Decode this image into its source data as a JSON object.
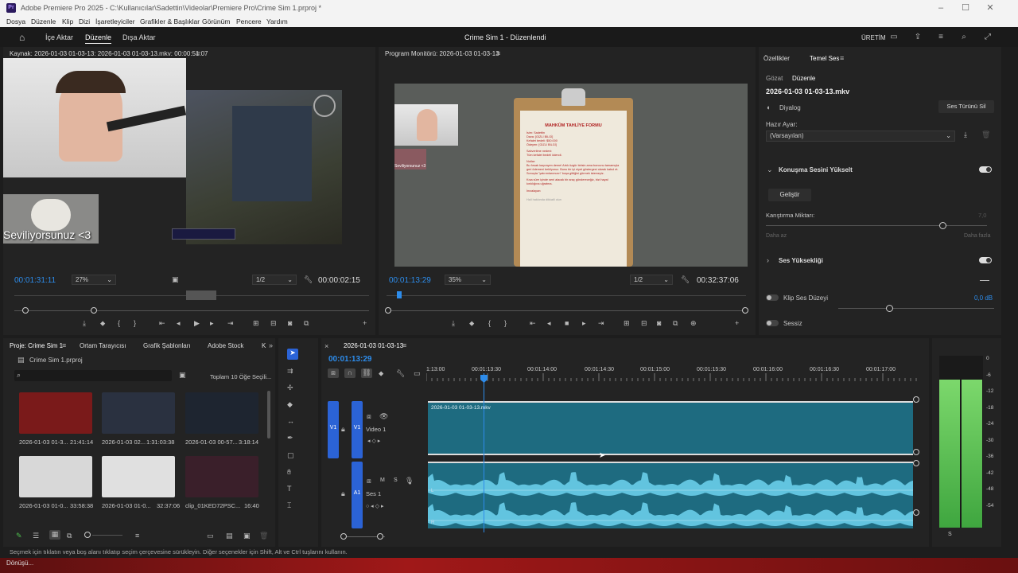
{
  "app": {
    "title": "Adobe Premiere Pro 2025 - C:\\Kullanıcılar\\Sadettin\\Videolar\\Premiere Pro\\Crime Sim 1.prproj *",
    "logo": "Pr"
  },
  "menu": [
    "Dosya",
    "Düzenle",
    "Klip",
    "Dizi",
    "İşaretleyiciler",
    "Grafikler & Başlıklar",
    "Görünüm",
    "Pencere",
    "Yardım"
  ],
  "workspace": {
    "tabs": [
      "İçe Aktar",
      "Düzenle",
      "Dışa Aktar"
    ],
    "project_title": "Crime Sim 1 - Düzenlendi",
    "output": "ÜRETİM"
  },
  "source": {
    "header": "Kaynak: 2026-01-03 01-03-13: 2026-01-03 01-03-13.mkv: 00:00:51:07",
    "timecode": "00:01:31:11",
    "zoom": "27%",
    "res": "1/2",
    "duration": "00:00:02:15",
    "overlay_text": "Seviliyorsunuz <3"
  },
  "program": {
    "header": "Program Monitörü: 2026-01-03 01-03-13",
    "timecode": "00:01:13:29",
    "zoom": "35%",
    "res": "1/2",
    "duration": "00:32:37:06",
    "doc_title": "MAHKÛM TAHLİYE FORMU",
    "small_overlay": "Seviliyorsunuz <3",
    "doc_lines": [
      "İsim: Sadettin",
      "Dava: [GİZLİ BİLGİ]",
      "Kefalet bedeli: $50.000",
      "Ödeyen: [GİZLİ BİLGİ]",
      "Salıverilme nedeni:",
      "Tüm kefalet bedeli ödendi.",
      "Notlar:",
      "Bu fırsatı kaçırayım deme! Artık özgür birisin ama borcunu tamamıyla geri ödemeni bekliyoruz. Bunu bir iyi niyet göstergesi olarak kabul et. Sonuçta \"yatırımlarımızın\" boşa gittiğini görmek istemeyiz.",
      "Kısa süre içinde seni alacak bir araç göndereceğiz, bizi hayal kırıklığına uğratma.",
      "İmzalayan:",
      "Hali hakkında dikkatli olun"
    ]
  },
  "props": {
    "tabs": [
      "Özellikler",
      "Temel Ses"
    ],
    "subtabs": [
      "Gözat",
      "Düzenle"
    ],
    "clip": "2026-01-03 01-03-13.mkv",
    "type": "Diyalog",
    "clear_btn": "Ses Türünü Sil",
    "preset_label": "Hazır Ayar:",
    "preset": "(Varsayılan)",
    "section1": "Konuşma Sesini Yükselt",
    "enhance_btn": "Geliştir",
    "mix_label": "Karıştırma Miktarı:",
    "mix_value": "7,0",
    "mix_level": 0.8,
    "less": "Daha az",
    "more": "Daha fazla",
    "section2": "Ses Yüksekliği",
    "clip_vol": "Klip Ses Düzeyi",
    "clip_vol_value": "0,0 dB",
    "mute": "Sessiz"
  },
  "project": {
    "tabs": [
      "Proje: Crime Sim 1",
      "Ortam Tarayıcısı",
      "Grafik Şablonları",
      "Adobe Stock",
      "K"
    ],
    "file": "Crime Sim 1.prproj",
    "search_placeholder": "",
    "count": "Toplam 10 Öğe Seçili...",
    "items": [
      {
        "name": "2026-01-03 01-3...",
        "dur": "21:41:14",
        "color": "#7a1a1a"
      },
      {
        "name": "2026-01-03 02...",
        "dur": "1:31:03:38",
        "color": "#2a3140"
      },
      {
        "name": "2026-01-03 00-57...",
        "dur": "3:18:14",
        "color": "#1e2530"
      },
      {
        "name": "2026-01-03 01-0...",
        "dur": "33:58:38",
        "color": "#d8d8d8"
      },
      {
        "name": "2026-01-03 01-0...",
        "dur": "32:37:06",
        "color": "#e0e0e0"
      },
      {
        "name": "clip_01KED72PSC...",
        "dur": "16:40",
        "color": "#3a1f2a"
      }
    ]
  },
  "timeline": {
    "tab": "2026-01-03 01-03-13",
    "timecode": "00:01:13:29",
    "ruler": [
      "1:13:00",
      "00:01:13:30",
      "00:01:14:00",
      "00:01:14:30",
      "00:01:15:00",
      "00:01:15:30",
      "00:01:16:00",
      "00:01:16:30",
      "00:01:17:00"
    ],
    "video_label": "V1",
    "video_name": "Video 1",
    "audio_label": "A1",
    "audio_name": "Ses 1",
    "clip_name": "2026-01-03 01-03-13.mkv",
    "meter_labels": [
      "0",
      "-6",
      "-12",
      "-18",
      "-24",
      "-30",
      "-36",
      "-42",
      "-48",
      "-54"
    ],
    "meter_foot": "S"
  },
  "status": {
    "hint": "Seçmek için tıklatın veya boş alanı tıklatıp seçim çerçevesine sürükleyin. Diğer seçenekler için Shift, Alt ve Ctrl tuşlarını kullanın.",
    "bottom": "Dönüşü..."
  },
  "colors": {
    "accent": "#2d8ceb",
    "clip": "#1e6b80",
    "wave": "#6fd3f0",
    "track": "#2b63d6",
    "meter": "#4fc24f"
  }
}
